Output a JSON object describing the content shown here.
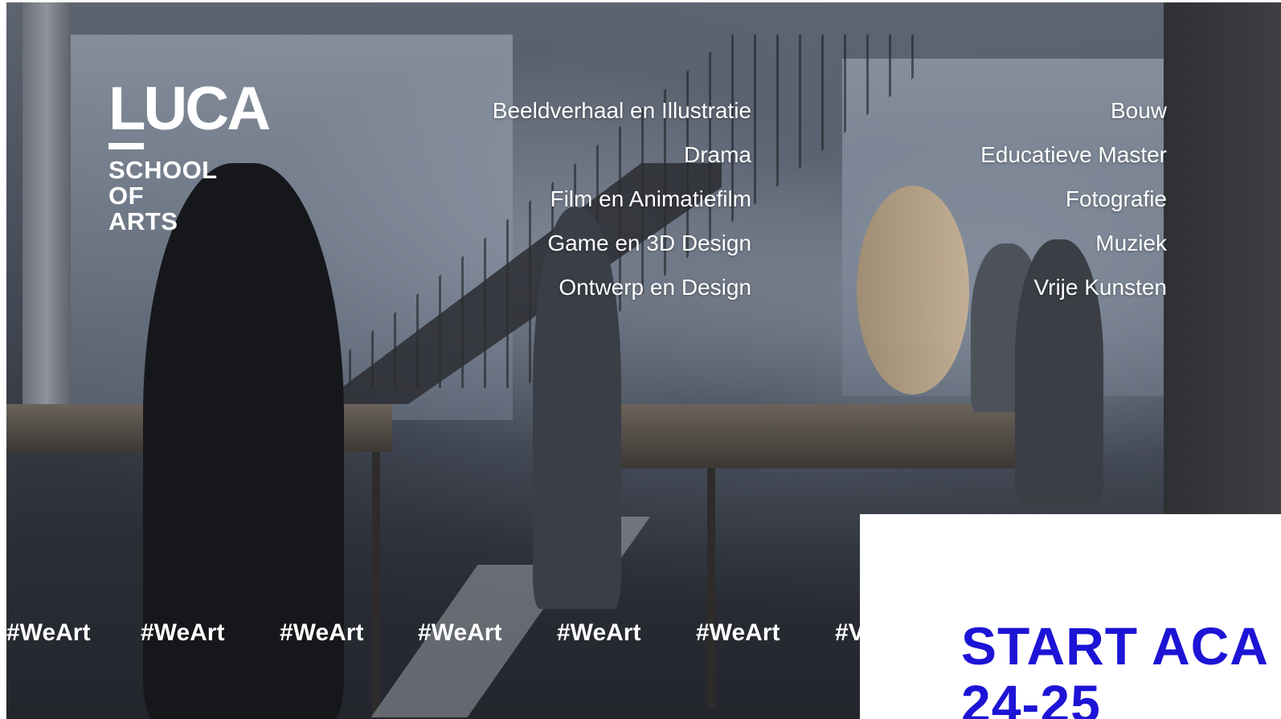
{
  "logo": {
    "mark": "LUCA",
    "sub_lines": [
      "SCHOOL",
      "OF",
      "ARTS"
    ]
  },
  "nav": {
    "left": [
      "Beeldverhaal en Illustratie",
      "Drama",
      "Film en Animatiefilm",
      "Game en 3D Design",
      "Ontwerp en Design"
    ],
    "right": [
      "Bouw",
      "Educatieve Master",
      "Fotografie",
      "Muziek",
      "Vrije Kunsten"
    ]
  },
  "ticker": {
    "items": [
      "#WeArt",
      "#WeArt",
      "#WeArt",
      "#WeArt",
      "#WeArt",
      "#WeArt",
      "#V"
    ]
  },
  "promo": {
    "title_line1": "START ACA",
    "title_line2": "24-25"
  },
  "colors": {
    "accent_blue": "#1d14d6",
    "text_on_hero": "#ffffff"
  }
}
